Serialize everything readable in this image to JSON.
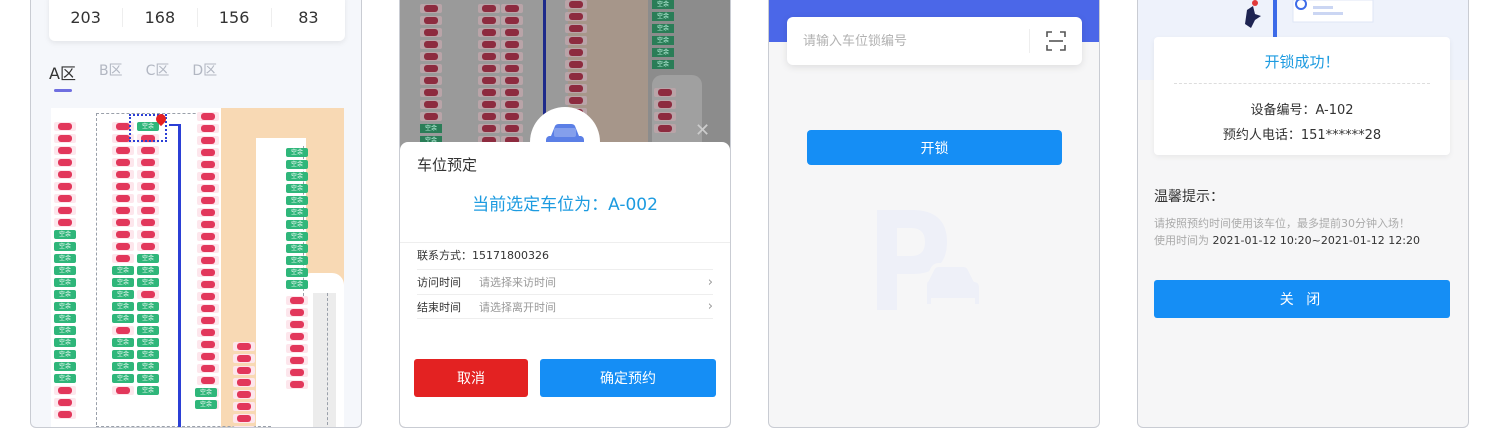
{
  "map_screen": {
    "stats": [
      "203",
      "168",
      "156",
      "83"
    ],
    "zones": [
      "A区",
      "B区",
      "C区",
      "D区"
    ],
    "active_zone": "A区",
    "free_label": "空余"
  },
  "booking_screen": {
    "title": "车位预定",
    "selected_text": "当前选定车位为：A-002",
    "contact_label": "联系方式：",
    "contact_value": "15171800326",
    "visit_label": "访问时间",
    "visit_placeholder": "请选择来访时间",
    "end_label": "结束时间",
    "end_placeholder": "请选择离开时间",
    "cancel_label": "取消",
    "confirm_label": "确定预约"
  },
  "unlock_screen": {
    "input_placeholder": "请输入车位锁编号",
    "unlock_label": "开锁"
  },
  "success_screen": {
    "success_title": "开锁成功！",
    "device_line": "设备编号：A-102",
    "phone_line": "预约人电话：151******28",
    "tips_title": "温馨提示：",
    "tip_line_1": "请按照预约时间使用该车位，最多提前30分钟入场！",
    "tip_line_2_prefix": "使用时间为",
    "tip_line_2_time": "2021-01-12 10:20~2021-01-12 12:20",
    "close_label": "关 闭"
  },
  "colors": {
    "primary_blue": "#158ef5",
    "cancel_red": "#e32222",
    "free_green": "#2fb67a",
    "occupied_red": "#e2375b",
    "road_orange": "#f8d9b4"
  }
}
